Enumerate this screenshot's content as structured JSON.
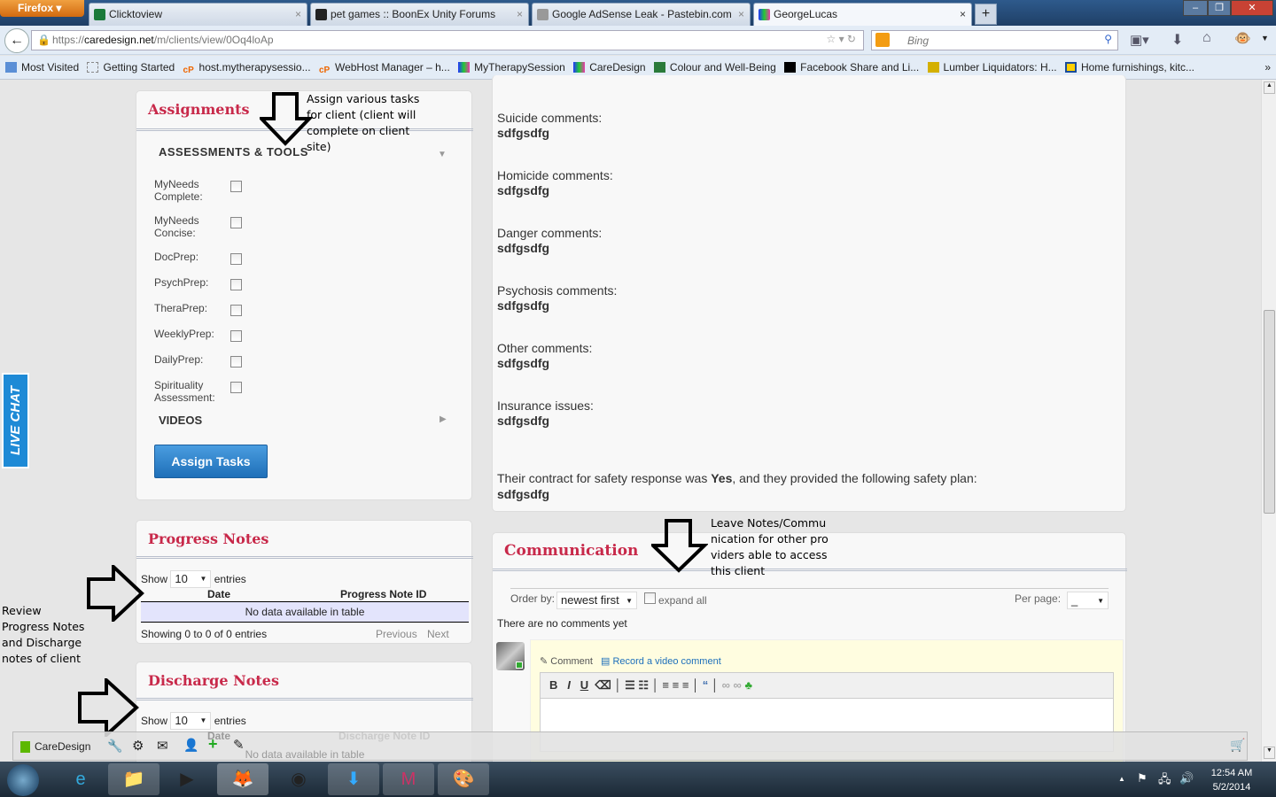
{
  "browser": {
    "menu_button": "Firefox",
    "tabs": [
      {
        "title": "Clicktoview"
      },
      {
        "title": "pet games :: BoonEx Unity Forums"
      },
      {
        "title": "Google AdSense Leak - Pastebin.com"
      },
      {
        "title": "GeorgeLucas",
        "active": true
      }
    ],
    "url_prefix": "https://",
    "url_domain": "caredesign.net",
    "url_path": "/m/clients/view/0Oq4loAp",
    "search_placeholder": "Bing",
    "bookmarks": [
      "Most Visited",
      "Getting Started",
      "host.mytherapysessio...",
      "WebHost Manager – h...",
      "MyTherapySession",
      "CareDesign",
      "Colour and Well-Being",
      "Facebook Share and Li...",
      "Lumber Liquidators: H...",
      "Home furnishings, kitc..."
    ]
  },
  "assignments": {
    "title": "Assignments",
    "section": "ASSESSMENTS & TOOLS",
    "items": [
      {
        "label": "MyNeeds Complete:"
      },
      {
        "label": "MyNeeds Concise:"
      },
      {
        "label": "DocPrep:"
      },
      {
        "label": "PsychPrep:"
      },
      {
        "label": "TheraPrep:"
      },
      {
        "label": "WeeklyPrep:"
      },
      {
        "label": "DailyPrep:"
      },
      {
        "label": "Spirituality Assessment:"
      }
    ],
    "videos": "VIDEOS",
    "assign_button": "Assign Tasks"
  },
  "annotations": {
    "assign": "Assign various tasks for client (client will complete on client site)",
    "notes": "Review Progress Notes and Discharge notes of client",
    "communication": "Leave Notes/Communication for other providers able to access this client"
  },
  "progress_notes": {
    "title": "Progress Notes",
    "show": "Show",
    "entries_value": "10",
    "entries": "entries",
    "col_date": "Date",
    "col_id": "Progress Note ID",
    "empty": "No data available in table",
    "info": "Showing 0 to 0 of 0 entries",
    "prev": "Previous",
    "next": "Next"
  },
  "discharge_notes": {
    "title": "Discharge Notes",
    "show": "Show",
    "entries_value": "10",
    "entries": "entries",
    "col_date": "Date",
    "col_id": "Discharge Note ID",
    "empty": "No data available in table"
  },
  "safety": {
    "fields": [
      {
        "label": "Suicide comments:",
        "value": "sdfgsdfg"
      },
      {
        "label": "Homicide comments:",
        "value": "sdfgsdfg"
      },
      {
        "label": "Danger comments:",
        "value": "sdfgsdfg"
      },
      {
        "label": "Psychosis comments:",
        "value": "sdfgsdfg"
      },
      {
        "label": "Other comments:",
        "value": "sdfgsdfg"
      },
      {
        "label": "Insurance issues:",
        "value": "sdfgsdfg"
      }
    ],
    "contract_pre": "Their contract for safety response was ",
    "contract_value": "Yes",
    "contract_post": ", and they provided the following safety plan:",
    "plan": "sdfgsdfg"
  },
  "communication": {
    "title": "Communication",
    "order_by": "Order by:",
    "order_value": "newest first",
    "expand_all": "expand all",
    "per_page": "Per page:",
    "per_page_value": "_",
    "no_comments": "There are no comments yet",
    "comment_tab": "Comment",
    "video_tab": "Record a video comment"
  },
  "live_chat": "LIVE CHAT",
  "bottom_bar": {
    "brand": "CareDesign"
  },
  "taskbar": {
    "time": "12:54 AM",
    "date": "5/2/2014"
  }
}
